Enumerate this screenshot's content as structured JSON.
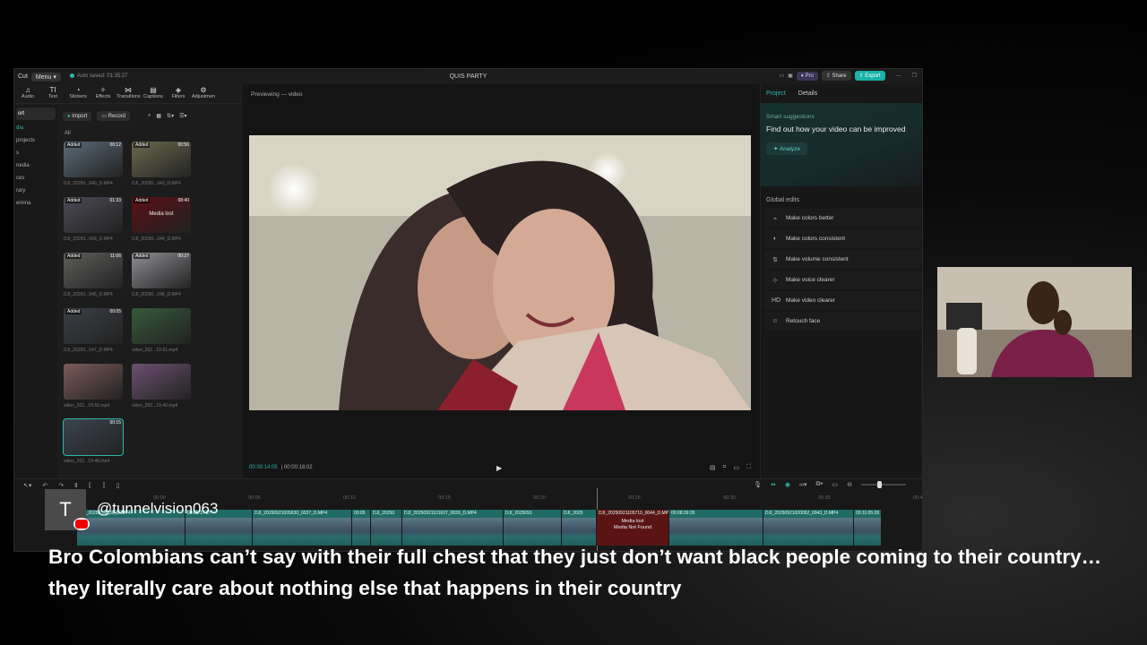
{
  "app": {
    "logo": "Cut",
    "menu_label": "Menu",
    "autosave": "Auto saved: 01:35:27",
    "project_title": "QUIS PARTY",
    "pro_label": "Pro",
    "share_label": "Share",
    "export_label": "Export"
  },
  "tools": [
    {
      "icon": "music-icon",
      "label": "Audio"
    },
    {
      "icon": "text-icon",
      "label": "Text"
    },
    {
      "icon": "sticker-icon",
      "label": "Stickers"
    },
    {
      "icon": "effects-icon",
      "label": "Effects"
    },
    {
      "icon": "transitions-icon",
      "label": "Transitions"
    },
    {
      "icon": "captions-icon",
      "label": "Captions"
    },
    {
      "icon": "filters-icon",
      "label": "Filters"
    },
    {
      "icon": "adjustment-icon",
      "label": "Adjustmen"
    }
  ],
  "sidenav": [
    "ort",
    "dia",
    "projects",
    "s",
    "nedia",
    "ces",
    "rary",
    "emina"
  ],
  "media": {
    "import_label": "Import",
    "record_label": "Record",
    "filter_all": "All",
    "items": [
      {
        "name": "DJI_20250...040_D.MP4",
        "badge": "Added",
        "duration": "00:12",
        "bg": "#5a6a78"
      },
      {
        "name": "DJI_20250...043_D.MP4",
        "badge": "Added",
        "duration": "00:56",
        "bg": "#6b6a4e"
      },
      {
        "name": "DJI_20250...043_D.MP4",
        "badge": "Added",
        "duration": "01:33",
        "bg": "#4b4b55"
      },
      {
        "name": "DJI_20250...044_D.MP4",
        "badge": "Added",
        "duration": "08:40",
        "bg": "#5c0f14",
        "lost": "Media lost"
      },
      {
        "name": "DJI_20250...045_D.MP4",
        "badge": "Added",
        "duration": "11:06",
        "bg": "#5e5f5c"
      },
      {
        "name": "DJI_20250...046_D.MP4",
        "badge": "Added",
        "duration": "00:27",
        "bg": "#8f8f95"
      },
      {
        "name": "DJI_20250...047_D.MP4",
        "badge": "Added",
        "duration": "00:05",
        "bg": "#3b3f45"
      },
      {
        "name": "video_202...19-51.mp4",
        "badge": "",
        "duration": "",
        "bg": "#355a3a"
      },
      {
        "name": "video_202...19-55.mp4",
        "badge": "",
        "duration": "",
        "bg": "#7d5a5a"
      },
      {
        "name": "video_202...19-40.mp4",
        "badge": "",
        "duration": "",
        "bg": "#6c5070"
      },
      {
        "name": "video_202...19-46.mp4",
        "badge": "",
        "duration": "00:15",
        "bg": "#3a4450",
        "selected": true
      }
    ]
  },
  "preview": {
    "title": "Previewing — video",
    "time_current": "00:00:14:05",
    "time_total": "00:00:18:02"
  },
  "details": {
    "tab_project": "Project",
    "tab_details": "Details",
    "smart_header": "Smart suggestions",
    "smart_text": "Find out how your video can be improved",
    "analyze_label": "Analyze",
    "global_edits_header": "Global edits",
    "edits": [
      {
        "icon": "wand-icon",
        "label": "Make colors better"
      },
      {
        "icon": "palette-icon",
        "label": "Make colors consistent"
      },
      {
        "icon": "volume-icon",
        "label": "Make volume consistent"
      },
      {
        "icon": "voice-icon",
        "label": "Make voice clearer"
      },
      {
        "icon": "hd-icon",
        "label": "Make video clearer"
      },
      {
        "icon": "face-icon",
        "label": "Retouch face"
      }
    ]
  },
  "timeline": {
    "ruler": [
      "00:00",
      "00:05",
      "00:10",
      "00:15",
      "00:20",
      "00:25",
      "00:30",
      "00:35",
      "00:40",
      "00:45",
      "00:50"
    ],
    "clips": [
      {
        "name": "DJI_20250...0036_D.MP4",
        "width": 120
      },
      {
        "name": "00:05:17:27",
        "width": 74
      },
      {
        "name": "DJI_20250921005630_0037_D.MP4",
        "width": 110
      },
      {
        "name": "00:05",
        "width": 20
      },
      {
        "name": "DJI_20250",
        "width": 34
      },
      {
        "name": "DJI_20250921101637_0039_D.MP4",
        "width": 112
      },
      {
        "name": "DJI_2025091",
        "width": 64
      },
      {
        "name": "DJI_2025",
        "width": 38
      },
      {
        "name": "DJI_20250921105710_0044_D.MP4",
        "width": 80,
        "lost": true,
        "lost_text_1": "Media lost",
        "lost_text_2": "Media Not Found"
      },
      {
        "name": "00:08:39:26",
        "width": 104
      },
      {
        "name": "DJI_20250921020052_0043_D.MP4",
        "width": 100
      },
      {
        "name": "00:11:05:28",
        "width": 30
      }
    ]
  },
  "overlay": {
    "avatar_letter": "T",
    "channel": "@tunnelvision063",
    "caption": "Bro Colombians can’t say with their full chest that they just don’t want black people coming to their country… they literally care about nothing else that happens in their country"
  }
}
